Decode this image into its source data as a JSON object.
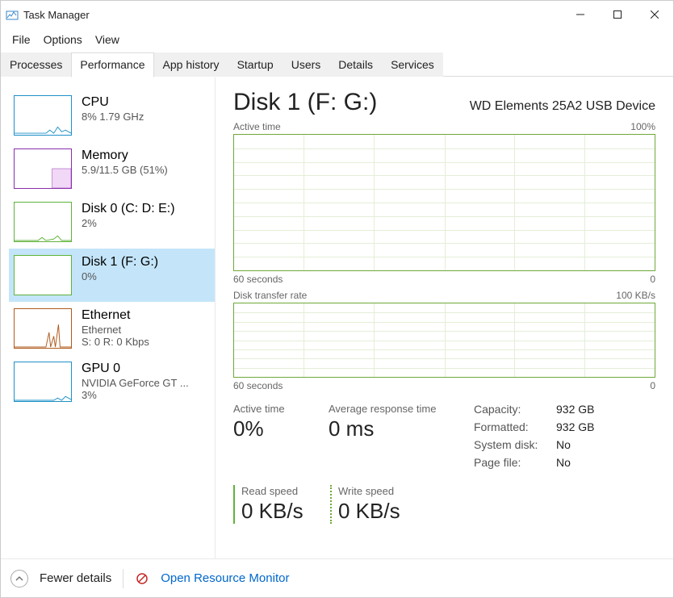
{
  "window": {
    "title": "Task Manager"
  },
  "menu": {
    "file": "File",
    "options": "Options",
    "view": "View"
  },
  "tabs": {
    "processes": "Processes",
    "performance": "Performance",
    "app_history": "App history",
    "startup": "Startup",
    "users": "Users",
    "details": "Details",
    "services": "Services"
  },
  "sidebar": {
    "items": [
      {
        "title": "CPU",
        "sub": "8%  1.79 GHz",
        "color": "#1e90c8"
      },
      {
        "title": "Memory",
        "sub": "5.9/11.5 GB (51%)",
        "color": "#8a2ea9"
      },
      {
        "title": "Disk 0 (C: D: E:)",
        "sub": "2%",
        "color": "#5fb33a"
      },
      {
        "title": "Disk 1 (F: G:)",
        "sub": "0%",
        "color": "#5fb33a"
      },
      {
        "title": "Ethernet",
        "sub": "Ethernet",
        "sub2": "S: 0  R: 0 Kbps",
        "color": "#b05a1c"
      },
      {
        "title": "GPU 0",
        "sub": "NVIDIA GeForce GT ...",
        "sub2": "3%",
        "color": "#1e90c8"
      }
    ]
  },
  "main": {
    "title": "Disk 1 (F: G:)",
    "device": "WD Elements 25A2 USB Device",
    "chart1": {
      "label": "Active time",
      "max": "100%",
      "xleft": "60 seconds",
      "xright": "0"
    },
    "chart2": {
      "label": "Disk transfer rate",
      "max": "100 KB/s",
      "xleft": "60 seconds",
      "xright": "0"
    },
    "stats": {
      "active_time_label": "Active time",
      "active_time_value": "0%",
      "avg_resp_label": "Average response time",
      "avg_resp_value": "0 ms"
    },
    "specs": {
      "capacity_k": "Capacity:",
      "capacity_v": "932 GB",
      "formatted_k": "Formatted:",
      "formatted_v": "932 GB",
      "sysdisk_k": "System disk:",
      "sysdisk_v": "No",
      "pagefile_k": "Page file:",
      "pagefile_v": "No"
    },
    "rw": {
      "read_label": "Read speed",
      "read_value": "0 KB/s",
      "write_label": "Write speed",
      "write_value": "0 KB/s"
    }
  },
  "footer": {
    "fewer": "Fewer details",
    "link": "Open Resource Monitor"
  },
  "chart_data": [
    {
      "type": "line",
      "title": "Active time",
      "ylabel": "%",
      "ylim": [
        0,
        100
      ],
      "x_range_seconds": [
        60,
        0
      ],
      "series": [
        {
          "name": "Active time",
          "values": []
        }
      ]
    },
    {
      "type": "line",
      "title": "Disk transfer rate",
      "ylabel": "KB/s",
      "ylim": [
        0,
        100
      ],
      "x_range_seconds": [
        60,
        0
      ],
      "series": [
        {
          "name": "Read",
          "values": []
        },
        {
          "name": "Write",
          "values": []
        }
      ]
    }
  ]
}
